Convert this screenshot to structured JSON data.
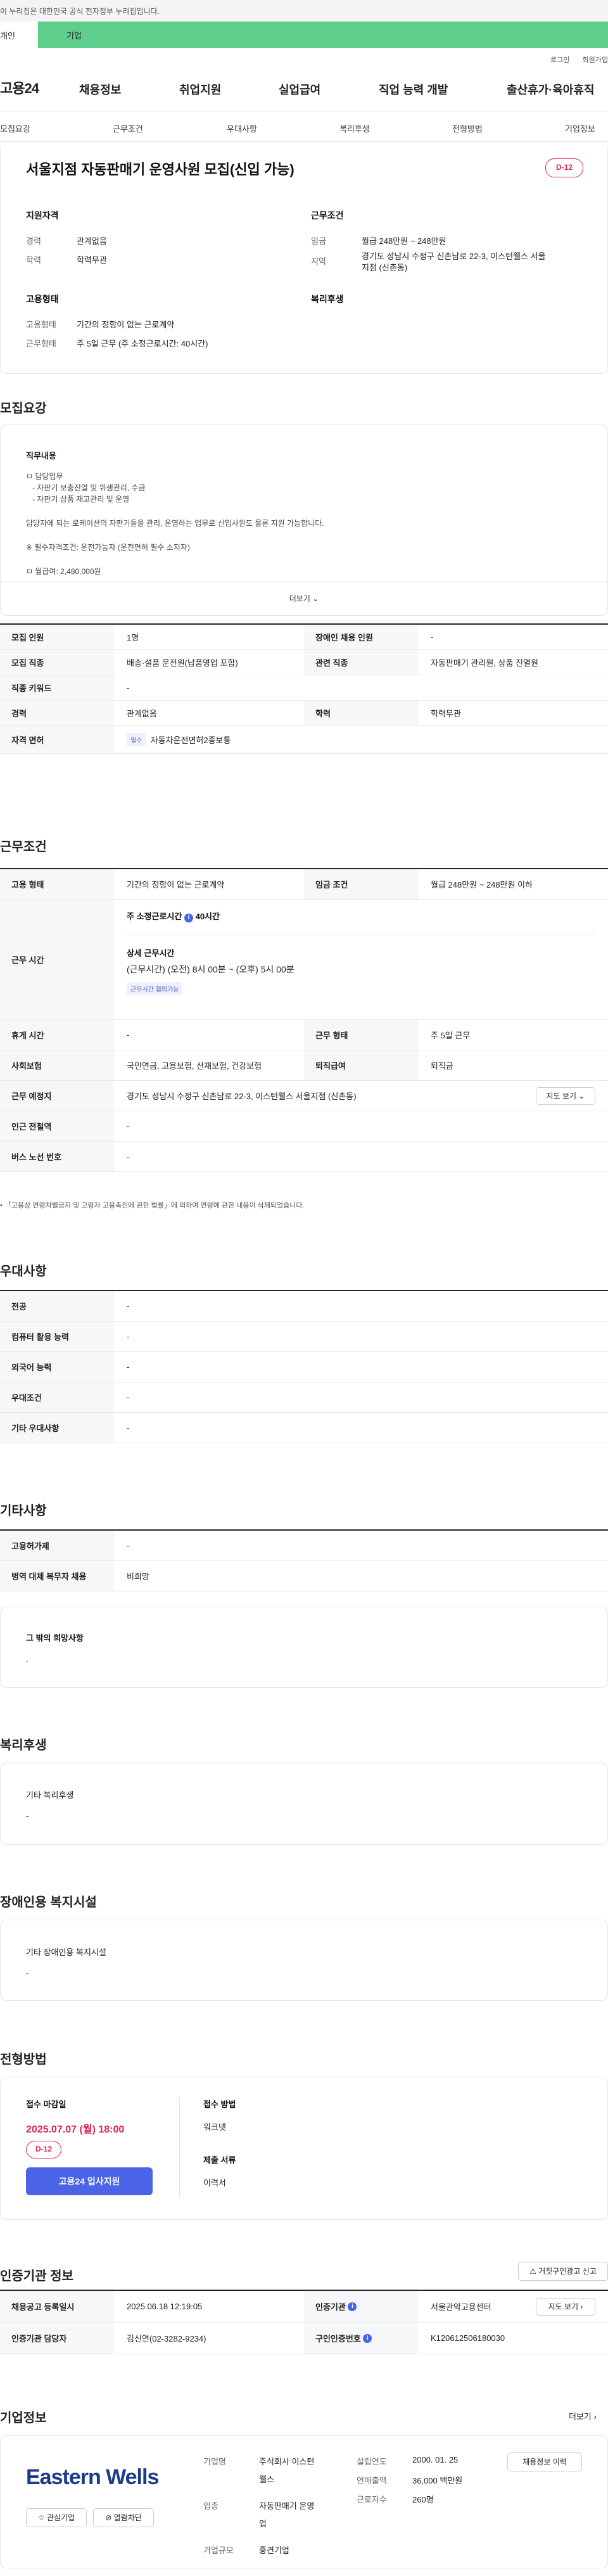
{
  "gov_banner": "이 누리집은 대한민국 공식 전자정부 누리집입니다.",
  "top_tabs": {
    "individual": "개인",
    "company": "기업"
  },
  "util": {
    "login": "로그인",
    "signup": "회원가입"
  },
  "gnb": {
    "logo": "고용24",
    "items": [
      "채용정보",
      "취업지원",
      "실업급여",
      "직업 능력 개발",
      "출산휴가·육아휴직"
    ]
  },
  "subnav": [
    "모집요강",
    "근무조건",
    "우대사항",
    "복리후생",
    "전형방법",
    "기업정보"
  ],
  "summary": {
    "title": "서울지점 자동판매기 운영사원 모집(신입 가능)",
    "dday": "D-12",
    "qual_head": "지원자격",
    "career_label": "경력",
    "career_value": "관계없음",
    "edu_label": "학력",
    "edu_value": "학력무관",
    "cond_head": "근무조건",
    "wage_label": "임금",
    "wage_value": "월급 248만원 ~ 248만원",
    "region_label": "지역",
    "region_value1": "경기도 성남시 수정구 신촌남로 22-3, 이스턴웰스 서울",
    "region_value2": "지점 (신촌동)",
    "emp_head": "고용형태",
    "emp_type_label": "고용형태",
    "emp_type_value": "기간의 정함이 없는 근로계약",
    "work_type_label": "근무형태",
    "work_type_value": "주 5일 근무 (주 소정근로시간: 40시간)",
    "welfare_head": "복리후생"
  },
  "recruit": {
    "heading": "모집요강",
    "duty_head": "직무내용",
    "lines": [
      "ㅁ 담당업무",
      "  - 자판기 보충진열 및 위생관리, 수금",
      "  - 자판기 상품 재고관리 및 운영",
      "담당자에 되는 로케이션의 자판기들을 관리, 운영하는 업무로 신입사원도 물론 지원 가능합니다.",
      "※ 필수자격조건: 운전가능자 (운전면허 필수 소지자)",
      "ㅁ 월급여: 2,480,000원"
    ],
    "more": "더보기",
    "table": [
      {
        "l1": "모집 인원",
        "v1": "1명",
        "l2": "장애인 채용 인원",
        "v2": "-"
      },
      {
        "l1": "모집 직종",
        "v1": "배송·설품 운전원(납품영업 포함)",
        "l2": "관련 직종",
        "v2": "자동판매기 관리원, 상품 진열원"
      },
      {
        "l1": "직종 키워드",
        "v1": "-",
        "l2": "",
        "v2": ""
      },
      {
        "l1": "경력",
        "v1": "관계없음",
        "l2": "학력",
        "v2": "학력무관"
      }
    ],
    "license_label": "자격 면허",
    "license_tag": "필수",
    "license_value": "자동차운전면허2종보통"
  },
  "work": {
    "heading": "근무조건",
    "emp_label": "고용 형태",
    "emp_value": "기간의 정함이 없는 근로계약",
    "wage_label": "임금 조건",
    "wage_value": "월급 248만원 ~ 248만원 이하",
    "hours_label": "근무 시간",
    "hours_main": "주 소정근로시간",
    "hours_main_value": "40시간",
    "hours_detail_head": "상세 근무시간",
    "hours_detail": "(근무시간) (오전) 8시 00분 ~ (오후) 5시 00분",
    "hours_tag": "근무시간 협의가능",
    "rest_label": "휴게 시간",
    "rest_value": "-",
    "form_label": "근무 형태",
    "form_value": "주 5일 근무",
    "ins_label": "사회보험",
    "ins_value": "국민연금, 고용보험, 산재보험, 건강보험",
    "sev_label": "퇴직급여",
    "sev_value": "퇴직금",
    "place_label": "근무 예정지",
    "place_value": "경기도 성남시 수정구 신촌남로 22-3, 이스턴웰스 서울지점 (신촌동)",
    "map_btn": "지도 보기",
    "subway_label": "인근 전철역",
    "subway_value": "-",
    "bus_label": "버스 노선 번호",
    "bus_value": "-",
    "note": "「고용상 연령차별금지 및 고령자 고용촉진에 관한 법률」에 의하여 연령에 관한 내용이 삭제되었습니다."
  },
  "pref": {
    "heading": "우대사항",
    "rows": [
      {
        "label": "전공",
        "value": "-"
      },
      {
        "label": "컴퓨터 활용 능력",
        "value": "-"
      },
      {
        "label": "외국어 능력",
        "value": "-"
      },
      {
        "label": "우대조건",
        "value": "-"
      },
      {
        "label": "기타 우대사항",
        "value": "-"
      }
    ]
  },
  "etc": {
    "heading": "기타사항",
    "rows": [
      {
        "label": "고용허가제",
        "value": "-"
      },
      {
        "label": "병역 대체 복무자 채용",
        "value": "비희망"
      }
    ],
    "other_head": "그 밖의 희망사항",
    "other_value": "."
  },
  "welfare": {
    "heading": "복리후생",
    "head": "기타 복리후생",
    "value": "-"
  },
  "facility": {
    "heading": "장애인용 복지시설",
    "head": "기타 장애인용 복지시설",
    "value": "-"
  },
  "process": {
    "heading": "전형방법",
    "deadline_head": "접수 마감일",
    "deadline": "2025.07.07 (월) 18:00",
    "dday": "D-12",
    "apply_btn": "고용24 입사지원",
    "method_head": "접수 방법",
    "method_value": "워크넷",
    "docs_head": "제출 서류",
    "docs_value": "이력서"
  },
  "cert": {
    "heading": "인증기관 정보",
    "report_btn": "거짓구인광고 신고",
    "reg_label": "채용공고 등록일시",
    "reg_value": "2025.06.18 12:19:05",
    "agency_label": "인증기관",
    "agency_value": "서울관악고용센터",
    "map_btn": "지도 보기",
    "staff_label": "인증기관 담당자",
    "staff_value": "김신연(02-3282-9234)",
    "auth_label": "구인인증번호",
    "auth_value": "K120612506180030"
  },
  "company": {
    "heading": "기업정보",
    "more": "더보기",
    "logo_text": "Eastern Wells",
    "fav_btn": "관심기업",
    "block_btn": "열람차단",
    "name_label": "기업명",
    "name_value1": "주식회사 이스턴",
    "name_value2": "웰스",
    "industry_label": "업종",
    "industry_value1": "자동판매기 운영",
    "industry_value2": "업",
    "size_label": "기업규모",
    "size_value": "중견기업",
    "founded_label": "설립연도",
    "founded_value": "2000. 01. 25",
    "sales_label": "연매출액",
    "sales_value": "36,000 백만원",
    "staff_label": "근로자수",
    "staff_value": "260명",
    "history_btn": "채용정보 이력"
  },
  "colors": {
    "accent": "#4a63e7",
    "dday": "#e0245e",
    "green": "#5dce8b"
  }
}
